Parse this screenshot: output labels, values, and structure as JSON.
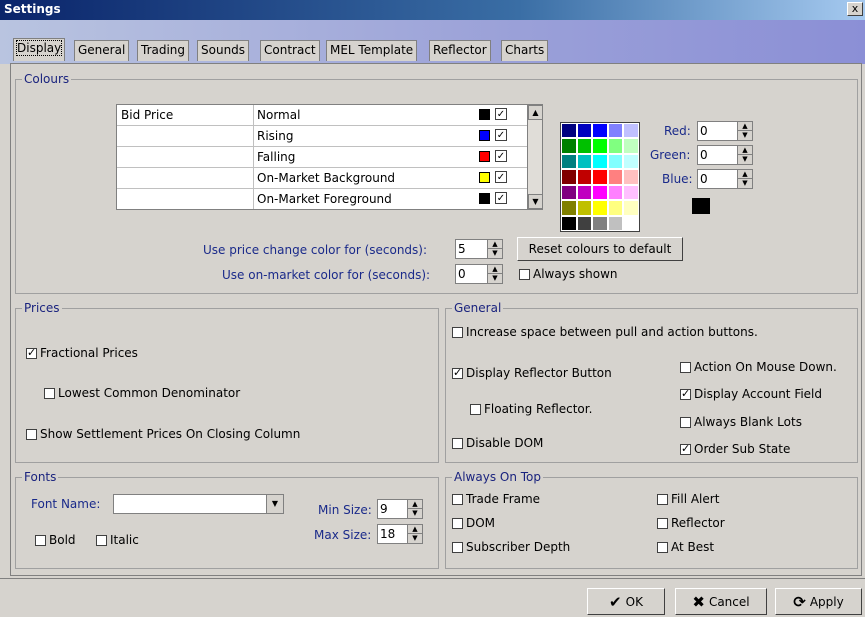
{
  "window": {
    "title": "Settings",
    "close_label": "x"
  },
  "tabs": [
    {
      "label": "Display",
      "active": true
    },
    {
      "label": "General"
    },
    {
      "label": "Trading"
    },
    {
      "label": "Sounds"
    },
    {
      "label": "Contract"
    },
    {
      "label": "MEL Template"
    },
    {
      "label": "Reflector"
    },
    {
      "label": "Charts"
    }
  ],
  "colours": {
    "legend": "Colours",
    "rows": [
      {
        "name": "Bid Price",
        "state": "Normal",
        "swatch": "#000000",
        "checked": true
      },
      {
        "name": "",
        "state": "Rising",
        "swatch": "#0000ff",
        "checked": true
      },
      {
        "name": "",
        "state": "Falling",
        "swatch": "#ff0000",
        "checked": true
      },
      {
        "name": "",
        "state": "On-Market Background",
        "swatch": "#ffff00",
        "checked": true
      },
      {
        "name": "",
        "state": "On-Market Foreground",
        "swatch": "#000000",
        "checked": true
      }
    ],
    "palette": [
      "#000080",
      "#0000c0",
      "#0000ff",
      "#8080ff",
      "#c0c0ff",
      "#008000",
      "#00c000",
      "#00ff00",
      "#80ff80",
      "#c0ffc0",
      "#008080",
      "#00c0c0",
      "#00ffff",
      "#80ffff",
      "#c0ffff",
      "#800000",
      "#c00000",
      "#ff0000",
      "#ff8080",
      "#ffc0c0",
      "#800080",
      "#c000c0",
      "#ff00ff",
      "#ff80ff",
      "#ffc0ff",
      "#808000",
      "#c0c000",
      "#ffff00",
      "#ffff80",
      "#ffffc0",
      "#000000",
      "#404040",
      "#808080",
      "#c0c0c0",
      "#ffffff"
    ],
    "red_label": "Red:",
    "red_value": "0",
    "green_label": "Green:",
    "green_value": "0",
    "blue_label": "Blue:",
    "blue_value": "0",
    "preview_color": "#000000",
    "price_change_label": "Use price change color for (seconds):",
    "price_change_value": "5",
    "on_market_label": "Use on-market color for (seconds):",
    "on_market_value": "0",
    "reset_label": "Reset colours to default",
    "always_shown_label": "Always shown",
    "always_shown_checked": false
  },
  "prices": {
    "legend": "Prices",
    "fractional_label": "Fractional Prices",
    "fractional_checked": true,
    "lcd_label": "Lowest Common Denominator",
    "lcd_checked": false,
    "settlement_label": "Show Settlement Prices On Closing Column",
    "settlement_checked": false
  },
  "general": {
    "legend": "General",
    "increase_space_label": "Increase space between pull and action buttons.",
    "increase_space_checked": false,
    "display_reflector_label": "Display Reflector Button",
    "display_reflector_checked": true,
    "floating_reflector_label": "Floating Reflector.",
    "floating_reflector_checked": false,
    "disable_dom_label": "Disable DOM",
    "disable_dom_checked": false,
    "action_mouse_down_label": "Action On Mouse Down.",
    "action_mouse_down_checked": false,
    "display_account_label": "Display Account Field",
    "display_account_checked": true,
    "always_blank_lots_label": "Always Blank Lots",
    "always_blank_lots_checked": false,
    "order_sub_state_label": "Order Sub State",
    "order_sub_state_checked": true
  },
  "fonts": {
    "legend": "Fonts",
    "font_name_label": "Font Name:",
    "font_name_value": "",
    "bold_label": "Bold",
    "bold_checked": false,
    "italic_label": "Italic",
    "italic_checked": false,
    "min_size_label": "Min Size:",
    "min_size_value": "9",
    "max_size_label": "Max Size:",
    "max_size_value": "18"
  },
  "always_on_top": {
    "legend": "Always On Top",
    "trade_frame_label": "Trade Frame",
    "trade_frame_checked": false,
    "dom_label": "DOM",
    "dom_checked": false,
    "subscriber_depth_label": "Subscriber Depth",
    "subscriber_depth_checked": false,
    "fill_alert_label": "Fill Alert",
    "fill_alert_checked": false,
    "reflector_label": "Reflector",
    "reflector_checked": false,
    "at_best_label": "At Best",
    "at_best_checked": false
  },
  "footer": {
    "ok_label": "OK",
    "cancel_label": "Cancel",
    "apply_label": "Apply"
  }
}
